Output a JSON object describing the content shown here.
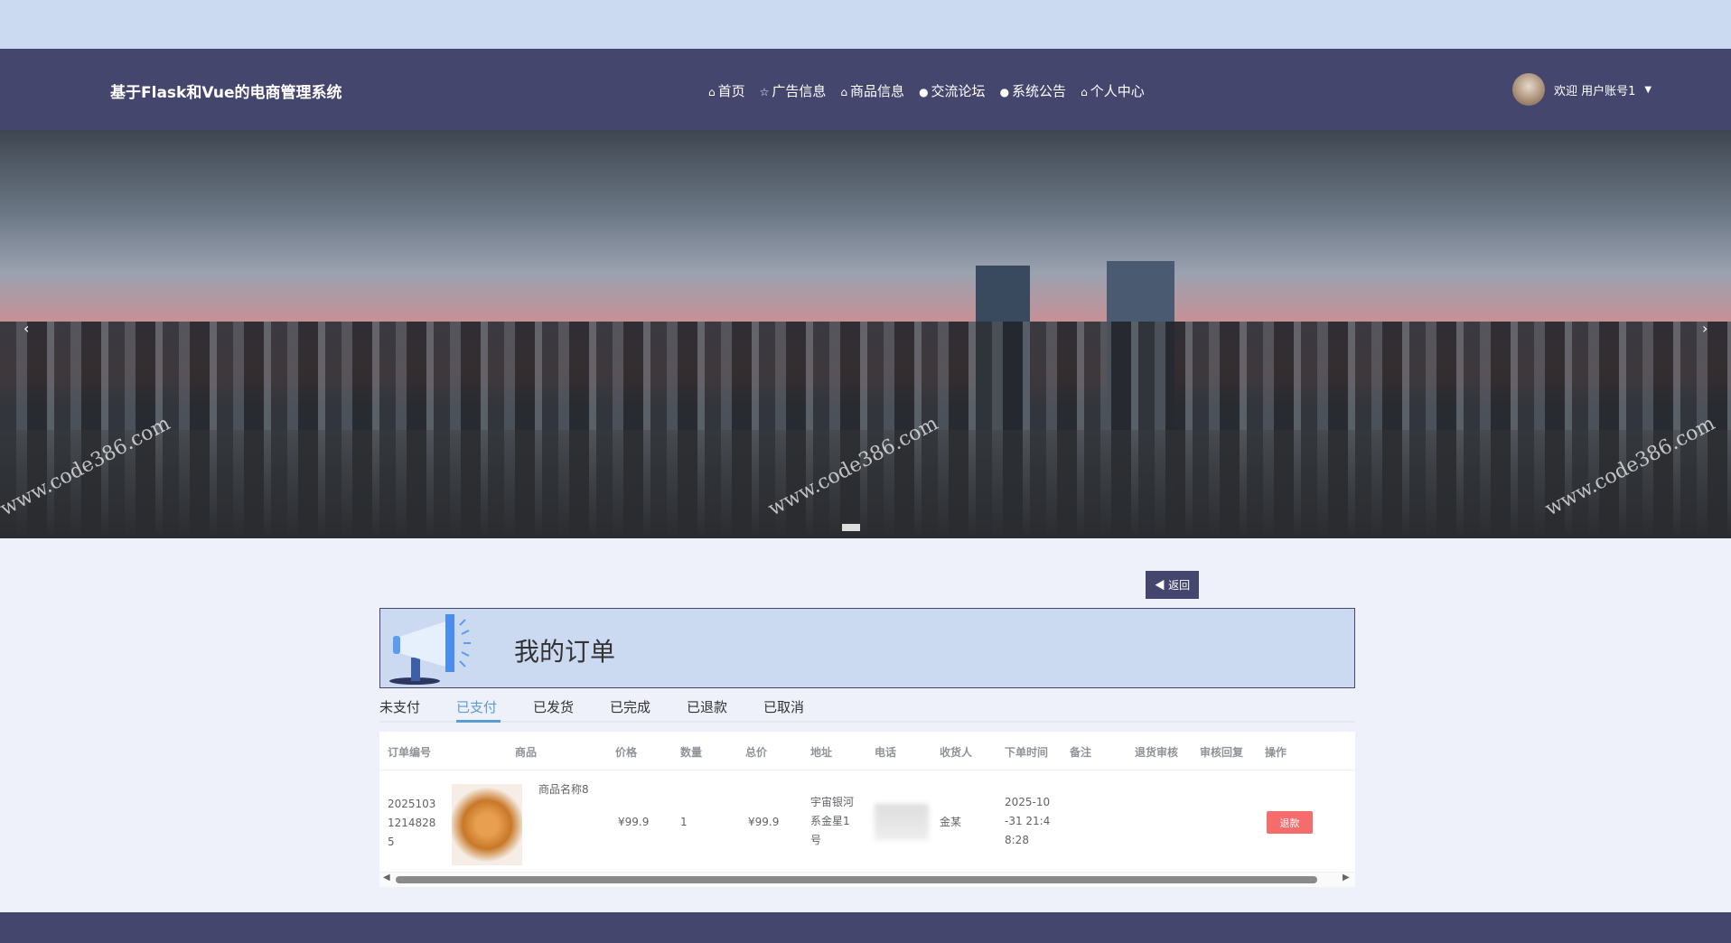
{
  "header": {
    "title": "基于Flask和Vue的电商管理系统",
    "menu": [
      {
        "icon": "home-icon",
        "glyph": "⌂",
        "label": "首页"
      },
      {
        "icon": "star-icon",
        "glyph": "☆",
        "label": "广告信息"
      },
      {
        "icon": "bag-icon",
        "glyph": "⌂",
        "label": "商品信息"
      },
      {
        "icon": "info-icon",
        "glyph": "●",
        "label": "交流论坛"
      },
      {
        "icon": "question-icon",
        "glyph": "●",
        "label": "系统公告"
      },
      {
        "icon": "home-icon",
        "glyph": "⌂",
        "label": "个人中心"
      }
    ],
    "user": "欢迎 用户账号1",
    "caret": "▼"
  },
  "banner": {
    "watermark": "www.code386.com",
    "prev": "‹",
    "next": "›"
  },
  "back_button": "◀ 返回",
  "page_title": "我的订单",
  "tabs": [
    "未支付",
    "已支付",
    "已发货",
    "已完成",
    "已退款",
    "已取消"
  ],
  "active_tab": "已支付",
  "table": {
    "columns": [
      "订单编号",
      "商品",
      "价格",
      "数量",
      "总价",
      "地址",
      "电话",
      "收货人",
      "下单时间",
      "备注",
      "退货审核",
      "审核回复",
      "操作"
    ],
    "rows": [
      {
        "order_no": "20251031214828​5",
        "product": "商品名称8",
        "price": "¥99.9",
        "qty": "1",
        "total": "¥99.9",
        "address": "宇宙银河系金星1号",
        "recipient": "金某",
        "time": "2025-10-31 21:48:28",
        "note": "",
        "refund_review": "",
        "review_reply": "",
        "action": "退款"
      }
    ]
  },
  "colors": {
    "nav": "#44466e",
    "accent": "#5d9cd1",
    "danger": "#f56c6c",
    "header_box": "#cbdaf1"
  }
}
